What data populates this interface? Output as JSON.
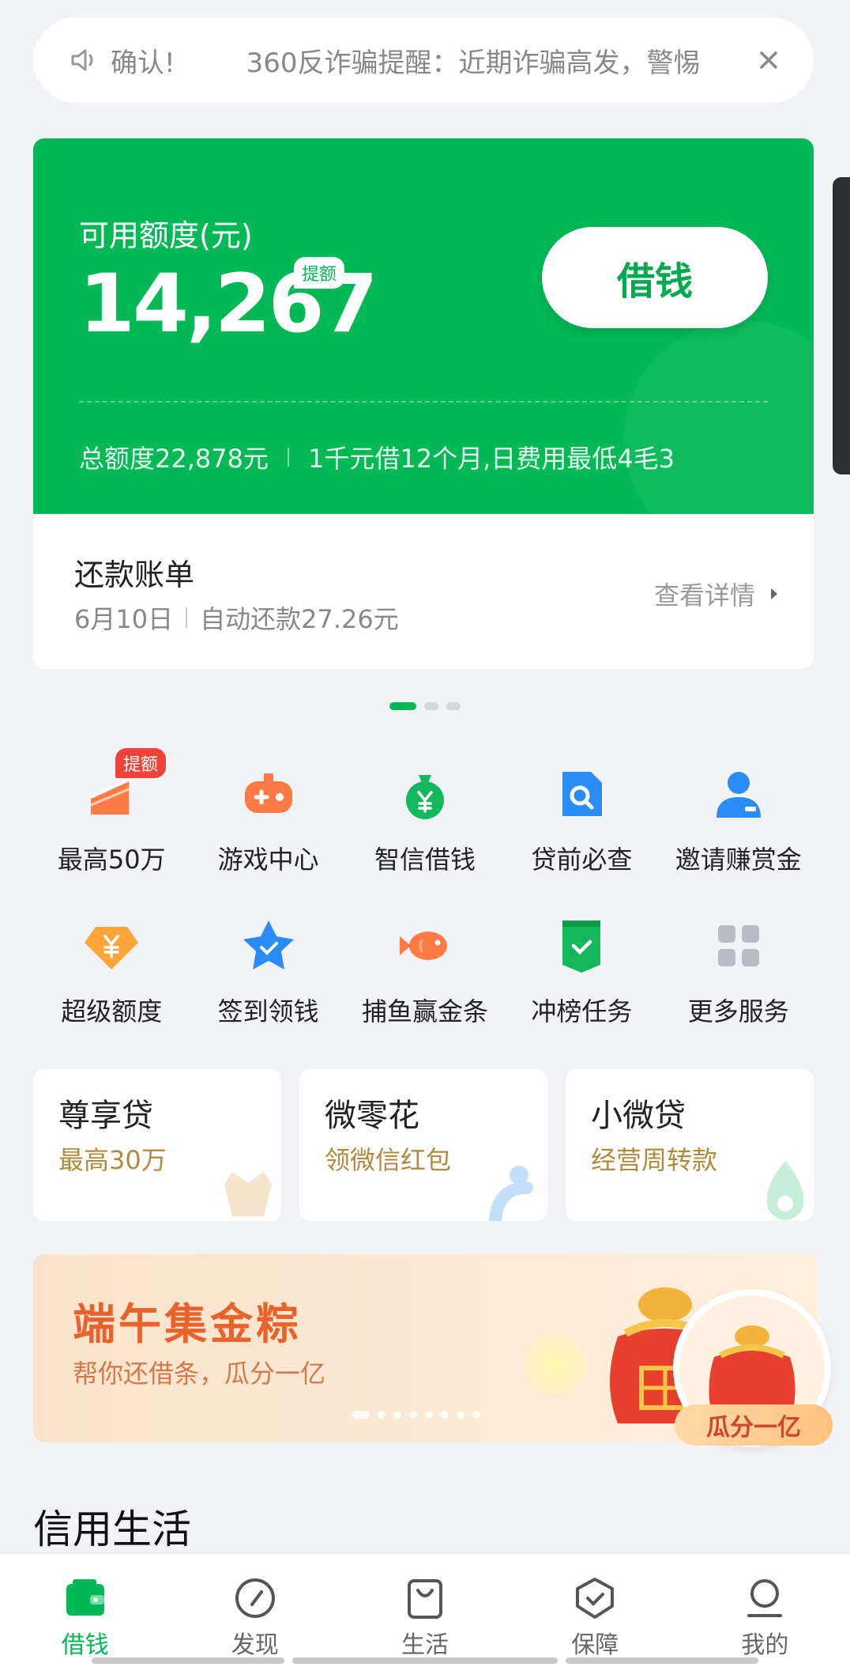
{
  "notice": {
    "confirm": "确认!",
    "text": "360反诈骗提醒：近期诈骗高发，警惕"
  },
  "credit": {
    "label": "可用额度(元)",
    "amount": "14,267",
    "tag": "提额",
    "borrow_button": "借钱",
    "total": "总额度22,878元",
    "promo": "1千元借12个月,日费用最低4毛3"
  },
  "repay": {
    "title": "还款账单",
    "date": "6月10日",
    "auto": "自动还款27.26元",
    "detail": "查看详情"
  },
  "services": [
    {
      "label": "最高50万",
      "icon": "growth-chart-icon",
      "badge": "提额"
    },
    {
      "label": "游戏中心",
      "icon": "gamepad-icon"
    },
    {
      "label": "智信借钱",
      "icon": "money-bag-icon"
    },
    {
      "label": "贷前必查",
      "icon": "document-search-icon"
    },
    {
      "label": "邀请赚赏金",
      "icon": "user-invite-icon"
    },
    {
      "label": "超级额度",
      "icon": "diamond-yuan-icon"
    },
    {
      "label": "签到领钱",
      "icon": "star-check-icon"
    },
    {
      "label": "捕鱼赢金条",
      "icon": "fish-icon"
    },
    {
      "label": "冲榜任务",
      "icon": "badge-check-icon"
    },
    {
      "label": "更多服务",
      "icon": "grid-icon"
    }
  ],
  "products": [
    {
      "title": "尊享贷",
      "sub": "最高30万"
    },
    {
      "title": "微零花",
      "sub": "领微信红包"
    },
    {
      "title": "小微贷",
      "sub": "经营周转款"
    }
  ],
  "banner": {
    "title": "端午集金粽",
    "sub": "帮你还借条，瓜分一亿",
    "bubble_tag": "瓜分一亿"
  },
  "section_title": "信用生活",
  "tabs": [
    {
      "label": "借钱",
      "icon": "wallet-icon",
      "active": true
    },
    {
      "label": "发现",
      "icon": "compass-icon"
    },
    {
      "label": "生活",
      "icon": "shopping-bag-icon"
    },
    {
      "label": "保障",
      "icon": "shield-check-icon"
    },
    {
      "label": "我的",
      "icon": "user-icon"
    }
  ],
  "colors": {
    "brand_green": "#02b955",
    "badge_red": "#f0433a",
    "gold_text": "#b08a3e",
    "banner_orange": "#e8632b"
  }
}
